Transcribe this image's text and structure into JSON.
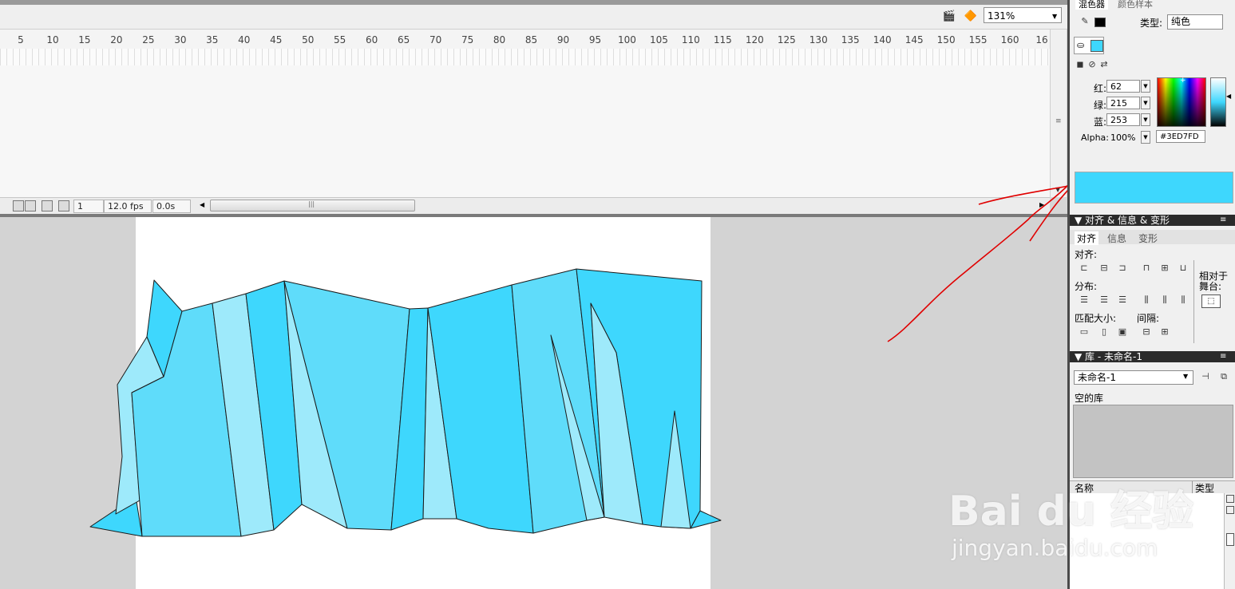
{
  "toolbar": {
    "zoom_value": "131%"
  },
  "timeline": {
    "ruler_ticks": [
      "5",
      "10",
      "15",
      "20",
      "25",
      "30",
      "35",
      "40",
      "45",
      "50",
      "55",
      "60",
      "65",
      "70",
      "75",
      "80",
      "85",
      "90",
      "95",
      "100",
      "105",
      "110",
      "115",
      "120",
      "125",
      "130",
      "135",
      "140",
      "145",
      "150",
      "155",
      "160",
      "16"
    ],
    "current_frame": "1",
    "frame_rate": "12.0 fps",
    "elapsed_time": "0.0s"
  },
  "panel": {
    "tabs": {
      "mixer": "混色器",
      "swatches": "颜色样本"
    },
    "type_label": "类型:",
    "type_value": "纯色",
    "red_label": "红:",
    "red_value": "62",
    "green_label": "绿:",
    "green_value": "215",
    "blue_label": "蓝:",
    "blue_value": "253",
    "alpha_label": "Alpha:",
    "alpha_value": "100%",
    "hex_value": "#3ED7FD",
    "fill_color": "#3ED7FD"
  },
  "align_panel": {
    "header": "▼ 对齐 & 信息 & 变形",
    "tabs": [
      "对齐",
      "信息",
      "变形"
    ],
    "align_label": "对齐:",
    "distribute_label": "分布:",
    "match_size_label": "匹配大小:",
    "spacing_label": "间隔:",
    "relative_label_1": "相对于",
    "relative_label_2": "舞台:"
  },
  "library_panel": {
    "header": "▼ 库 - 未命名-1",
    "document_select": "未命名-1",
    "empty_text": "空的库",
    "col_name": "名称",
    "col_type": "类型"
  },
  "watermark": {
    "text": "Bai du 经验",
    "url": "jingyan.baidu.com"
  },
  "colors": {
    "ice_dark": "#3ED7FD",
    "ice_mid": "#5FDCFA",
    "ice_light": "#9EEAFB",
    "annotation": "#E00000"
  }
}
